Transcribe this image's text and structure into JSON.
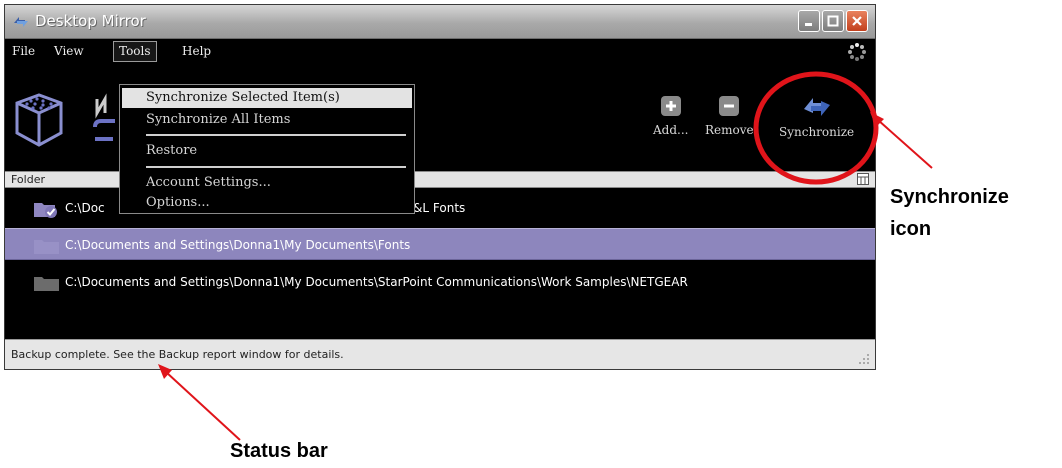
{
  "window": {
    "title": "Desktop Mirror"
  },
  "menubar": {
    "items": [
      {
        "label": "File"
      },
      {
        "label": "View"
      },
      {
        "label": "Tools"
      },
      {
        "label": "Help"
      }
    ]
  },
  "tools_menu": {
    "items": [
      {
        "label": "Synchronize Selected Item(s)"
      },
      {
        "label": "Synchronize All Items"
      },
      {
        "label": "Restore"
      },
      {
        "label": "Account Settings..."
      },
      {
        "label": "Options..."
      }
    ]
  },
  "toolbar": {
    "add_label": "Add...",
    "remove_label": "Remove",
    "synchronize_label": "Synchronize"
  },
  "list": {
    "column_header": "Folder",
    "rows": [
      {
        "path": "C:\\Documents and Settings\\Donna1\\My Documents\\A&L Fonts",
        "visible_prefix": "C:\\Doc",
        "visible_suffix": "\\&L Fonts",
        "checked": true
      },
      {
        "path": "C:\\Documents and Settings\\Donna1\\My Documents\\Fonts",
        "selected": true
      },
      {
        "path": "C:\\Documents and Settings\\Donna1\\My Documents\\StarPoint Communications\\Work Samples\\NETGEAR"
      }
    ]
  },
  "statusbar": {
    "text": "Backup complete.  See the Backup report window for details."
  },
  "annotations": {
    "sync_callout_line1": "Synchronize",
    "sync_callout_line2": "icon",
    "status_callout": "Status bar"
  },
  "colors": {
    "selection": "#8d86bd",
    "annotation_red": "#e0141a",
    "close_button": "#c2401d"
  }
}
